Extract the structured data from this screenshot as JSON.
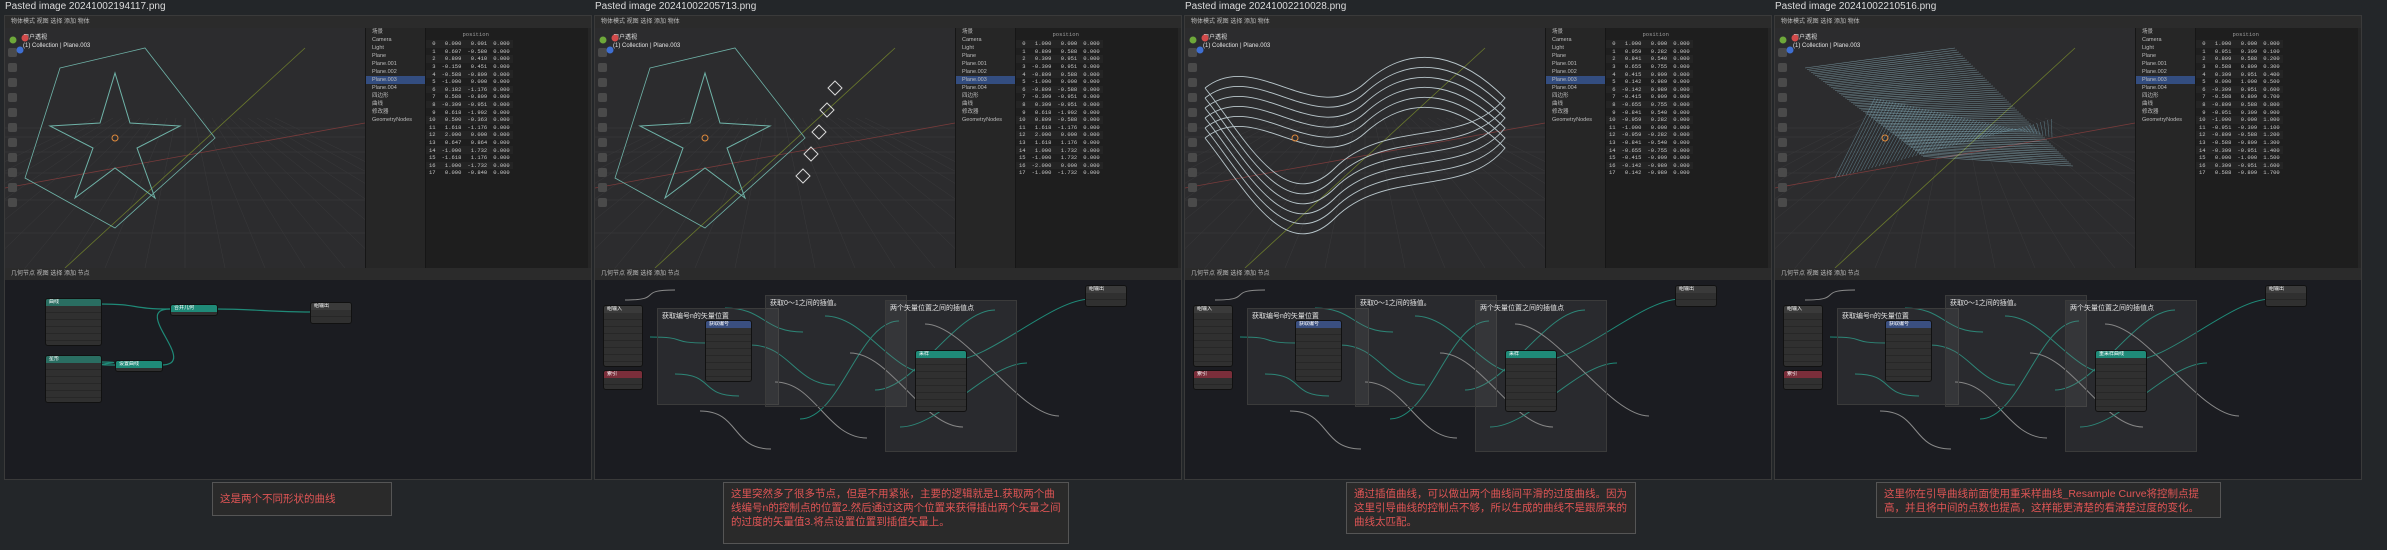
{
  "colors": {
    "accent_teal": "#1f8a78",
    "node_blue": "#3a4f80",
    "node_red": "#7a2e3a",
    "node_purple": "#4b3f7a",
    "note_red": "#e05555"
  },
  "panels": [
    {
      "title": "Pasted image 20241002194117.png",
      "vp_header": "物体模式  视图  选择  添加  物体",
      "vp_info": [
        "用户透视",
        "(1) Collection | Plane.003"
      ],
      "outliner": [
        "场景",
        "Camera",
        "Light",
        "Plane",
        "Plane.001",
        "Plane.002",
        "Plane.003",
        "Plane.004",
        "四边形",
        "曲线",
        "修改器",
        "GeometryNodes"
      ],
      "outliner_sel": 6,
      "ss_header": "position",
      "ss_rows": [
        [
          "0",
          "0.000",
          "0.001",
          "0.000"
        ],
        [
          "1",
          "0.607",
          "-0.580",
          "0.000"
        ],
        [
          "2",
          "0.809",
          "0.410",
          "0.000"
        ],
        [
          "3",
          "-0.159",
          "0.451",
          "0.000"
        ],
        [
          "4",
          "-0.588",
          "-0.809",
          "0.000"
        ],
        [
          "5",
          "-1.000",
          "0.000",
          "0.000"
        ],
        [
          "6",
          "0.182",
          "-1.176",
          "0.000"
        ],
        [
          "7",
          "0.588",
          "-0.809",
          "0.000"
        ],
        [
          "8",
          "-0.309",
          "-0.951",
          "0.000"
        ],
        [
          "9",
          "0.618",
          "-1.902",
          "0.000"
        ],
        [
          "10",
          "0.500",
          "-0.363",
          "0.000"
        ],
        [
          "11",
          "1.618",
          "-1.176",
          "0.000"
        ],
        [
          "12",
          "2.000",
          "0.000",
          "0.000"
        ],
        [
          "13",
          "0.647",
          "0.864",
          "0.000"
        ],
        [
          "14",
          "-1.000",
          "1.732",
          "0.000"
        ],
        [
          "15",
          "-1.618",
          "1.176",
          "0.000"
        ],
        [
          "16",
          "1.000",
          "-1.732",
          "0.000"
        ],
        [
          "17",
          "0.000",
          "-0.840",
          "0.000"
        ]
      ],
      "ne_header": "几何节点  视图  选择  添加  节点",
      "nodes": [
        [
          "曲线",
          "#2a6e62"
        ],
        [
          "合并几何",
          "#1f8a78"
        ],
        [
          "组输出",
          "#3a3a3a"
        ],
        [
          "星形",
          "#2a6e62"
        ],
        [
          "设置曲线",
          "#1f8a78"
        ]
      ],
      "frames": []
    },
    {
      "title": "Pasted image 20241002205713.png",
      "vp_header": "物体模式  视图  选择  添加  物体",
      "vp_info": [
        "用户透视",
        "(1) Collection | Plane.003"
      ],
      "outliner": [
        "场景",
        "Camera",
        "Light",
        "Plane",
        "Plane.001",
        "Plane.002",
        "Plane.003",
        "Plane.004",
        "四边形",
        "曲线",
        "修改器",
        "GeometryNodes"
      ],
      "outliner_sel": 6,
      "ss_header": "position",
      "ss_rows": [
        [
          "0",
          "1.000",
          "0.000",
          "0.000"
        ],
        [
          "1",
          "0.809",
          "0.588",
          "0.000"
        ],
        [
          "2",
          "0.309",
          "0.951",
          "0.000"
        ],
        [
          "3",
          "-0.309",
          "0.951",
          "0.000"
        ],
        [
          "4",
          "-0.809",
          "0.588",
          "0.000"
        ],
        [
          "5",
          "-1.000",
          "0.000",
          "0.000"
        ],
        [
          "6",
          "-0.809",
          "-0.588",
          "0.000"
        ],
        [
          "7",
          "-0.309",
          "-0.951",
          "0.000"
        ],
        [
          "8",
          "0.309",
          "-0.951",
          "0.000"
        ],
        [
          "9",
          "0.618",
          "-1.902",
          "0.000"
        ],
        [
          "10",
          "0.809",
          "-0.588",
          "0.000"
        ],
        [
          "11",
          "1.618",
          "-1.176",
          "0.000"
        ],
        [
          "12",
          "2.000",
          "0.000",
          "0.000"
        ],
        [
          "13",
          "1.618",
          "1.176",
          "0.000"
        ],
        [
          "14",
          "1.000",
          "1.732",
          "0.000"
        ],
        [
          "15",
          "-1.000",
          "1.732",
          "0.000"
        ],
        [
          "16",
          "-2.000",
          "0.000",
          "0.000"
        ],
        [
          "17",
          "-1.000",
          "-1.732",
          "0.000"
        ]
      ],
      "ne_header": "几何节点  视图  选择  添加  节点",
      "nodes": [
        [
          "组输入",
          "#3a3a3a"
        ],
        [
          "索引",
          "#7a2e3a"
        ],
        [
          "获取编号",
          "#3a4f80"
        ],
        [
          "采样",
          "#1f8a78"
        ],
        [
          "组输出",
          "#3a3a3a"
        ]
      ],
      "frames": [
        "获取编号n的矢量位置",
        "获取0～1之间的插值。",
        "两个矢量位置之间的插值点"
      ]
    },
    {
      "title": "Pasted image 20241002210028.png",
      "vp_header": "物体模式  视图  选择  添加  物体",
      "vp_info": [
        "用户透视",
        "(1) Collection | Plane.003"
      ],
      "outliner": [
        "场景",
        "Camera",
        "Light",
        "Plane",
        "Plane.001",
        "Plane.002",
        "Plane.003",
        "Plane.004",
        "四边形",
        "曲线",
        "修改器",
        "GeometryNodes"
      ],
      "outliner_sel": 6,
      "ss_header": "position",
      "ss_rows": [
        [
          "0",
          "1.000",
          "0.000",
          "0.000"
        ],
        [
          "1",
          "0.959",
          "0.282",
          "0.000"
        ],
        [
          "2",
          "0.841",
          "0.540",
          "0.000"
        ],
        [
          "3",
          "0.655",
          "0.755",
          "0.000"
        ],
        [
          "4",
          "0.415",
          "0.909",
          "0.000"
        ],
        [
          "5",
          "0.142",
          "0.989",
          "0.000"
        ],
        [
          "6",
          "-0.142",
          "0.989",
          "0.000"
        ],
        [
          "7",
          "-0.415",
          "0.909",
          "0.000"
        ],
        [
          "8",
          "-0.655",
          "0.755",
          "0.000"
        ],
        [
          "9",
          "-0.841",
          "0.540",
          "0.000"
        ],
        [
          "10",
          "-0.959",
          "0.282",
          "0.000"
        ],
        [
          "11",
          "-1.000",
          "0.000",
          "0.000"
        ],
        [
          "12",
          "-0.959",
          "-0.282",
          "0.000"
        ],
        [
          "13",
          "-0.841",
          "-0.540",
          "0.000"
        ],
        [
          "14",
          "-0.655",
          "-0.755",
          "0.000"
        ],
        [
          "15",
          "-0.415",
          "-0.909",
          "0.000"
        ],
        [
          "16",
          "-0.142",
          "-0.989",
          "0.000"
        ],
        [
          "17",
          "0.142",
          "-0.989",
          "0.000"
        ]
      ],
      "ne_header": "几何节点  视图  选择  添加  节点",
      "nodes": [
        [
          "组输入",
          "#3a3a3a"
        ],
        [
          "索引",
          "#7a2e3a"
        ],
        [
          "获取编号",
          "#3a4f80"
        ],
        [
          "采样",
          "#1f8a78"
        ],
        [
          "组输出",
          "#3a3a3a"
        ]
      ],
      "frames": [
        "获取编号n的矢量位置",
        "获取0～1之间的插值。",
        "两个矢量位置之间的插值点"
      ]
    },
    {
      "title": "Pasted image 20241002210516.png",
      "vp_header": "物体模式  视图  选择  添加  物体",
      "vp_info": [
        "用户透视",
        "(1) Collection | Plane.003"
      ],
      "outliner": [
        "场景",
        "Camera",
        "Light",
        "Plane",
        "Plane.001",
        "Plane.002",
        "Plane.003",
        "Plane.004",
        "四边形",
        "曲线",
        "修改器",
        "GeometryNodes"
      ],
      "outliner_sel": 6,
      "ss_header": "position",
      "ss_rows": [
        [
          "0",
          "1.000",
          "0.000",
          "0.000"
        ],
        [
          "1",
          "0.951",
          "0.309",
          "0.100"
        ],
        [
          "2",
          "0.809",
          "0.588",
          "0.200"
        ],
        [
          "3",
          "0.588",
          "0.809",
          "0.300"
        ],
        [
          "4",
          "0.309",
          "0.951",
          "0.400"
        ],
        [
          "5",
          "0.000",
          "1.000",
          "0.500"
        ],
        [
          "6",
          "-0.309",
          "0.951",
          "0.600"
        ],
        [
          "7",
          "-0.588",
          "0.809",
          "0.700"
        ],
        [
          "8",
          "-0.809",
          "0.588",
          "0.800"
        ],
        [
          "9",
          "-0.951",
          "0.309",
          "0.900"
        ],
        [
          "10",
          "-1.000",
          "0.000",
          "1.000"
        ],
        [
          "11",
          "-0.951",
          "-0.309",
          "1.100"
        ],
        [
          "12",
          "-0.809",
          "-0.588",
          "1.200"
        ],
        [
          "13",
          "-0.588",
          "-0.809",
          "1.300"
        ],
        [
          "14",
          "-0.309",
          "-0.951",
          "1.400"
        ],
        [
          "15",
          "0.000",
          "-1.000",
          "1.500"
        ],
        [
          "16",
          "0.309",
          "-0.951",
          "1.600"
        ],
        [
          "17",
          "0.588",
          "-0.809",
          "1.700"
        ]
      ],
      "ne_header": "几何节点  视图  选择  添加  节点",
      "nodes": [
        [
          "组输入",
          "#3a3a3a"
        ],
        [
          "索引",
          "#7a2e3a"
        ],
        [
          "获取编号",
          "#3a4f80"
        ],
        [
          "重采样曲线",
          "#1f8a78"
        ],
        [
          "组输出",
          "#3a3a3a"
        ]
      ],
      "frames": [
        "获取编号n的矢量位置",
        "获取0～1之间的插值。",
        "两个矢量位置之间的插值点"
      ]
    }
  ],
  "notes": [
    "这是两个不同形状的曲线",
    "这里突然多了很多节点，但是不用紧张，主要的逻辑就是1.获取两个曲线编号n的控制点的位置2.然后通过这两个位置来获得插出两个矢量之间的过度的矢量值3.将点设置位置到插值矢量上。",
    "通过插值曲线，可以做出两个曲线间平滑的过度曲线。因为这里引导曲线的控制点不够，所以生成的曲线不是跟原来的曲线太匹配。",
    "这里你在引导曲线前面使用重采样曲线_Resample Curve将控制点提高，并且将中间的点数也提高，这样能更清楚的看清楚过度的变化。"
  ]
}
